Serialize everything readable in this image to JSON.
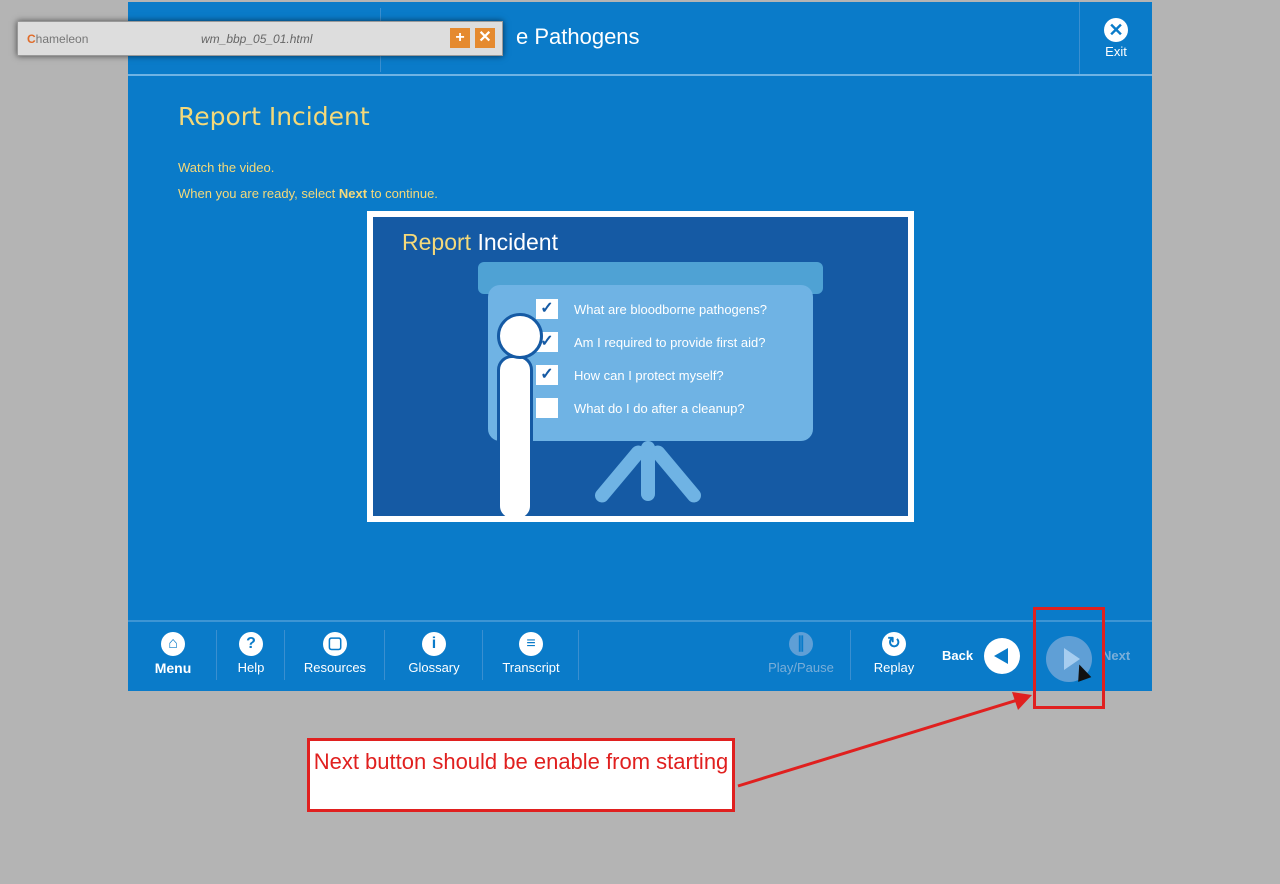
{
  "header": {
    "course_title": "e Pathogens",
    "exit_label": "Exit"
  },
  "toolbar_popup": {
    "logo_text": "hameleon",
    "file_name": "wm_bbp_05_01.html"
  },
  "content": {
    "heading": "Report Incident",
    "line1": "Watch the video.",
    "line2_prefix": "When you are ready, select ",
    "line2_bold": "Next",
    "line2_suffix": " to continue."
  },
  "video": {
    "title_part1": "Report",
    "title_part2": "Incident",
    "checklist": [
      {
        "text": "What are bloodborne pathogens?",
        "checked": true
      },
      {
        "text": "Am I required to provide first aid?",
        "checked": true
      },
      {
        "text": "How can I protect myself?",
        "checked": true
      },
      {
        "text": "What do I do after a cleanup?",
        "checked": false
      }
    ]
  },
  "footer": {
    "menu": "Menu",
    "help": "Help",
    "resources": "Resources",
    "glossary": "Glossary",
    "transcript": "Transcript",
    "play_pause": "Play/Pause",
    "replay": "Replay",
    "back": "Back",
    "next": "Next"
  },
  "annotation": {
    "callout_text": "Next button should be enable from starting",
    "color": "#e0201f"
  }
}
